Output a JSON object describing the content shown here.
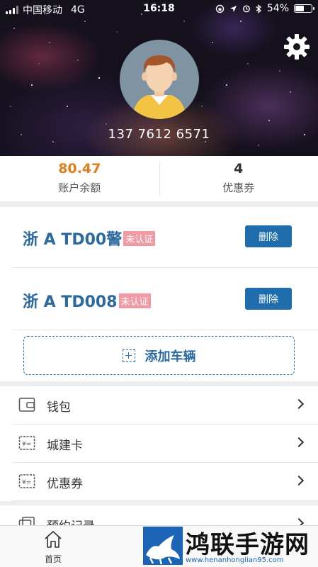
{
  "status_bar": {
    "carrier": "中国移动",
    "network": "4G",
    "time": "16:18",
    "battery": "54%",
    "battery_level": 0.54
  },
  "profile": {
    "phone": "137 7612 6571"
  },
  "summary": {
    "balance_value": "80.47",
    "balance_label": "账户余额",
    "coupon_value": "4",
    "coupon_label": "优惠券",
    "balance_color": "#e07d1c"
  },
  "vehicles": [
    {
      "plate": "浙 A TD00警",
      "status": "未认证",
      "action": "删除"
    },
    {
      "plate": "浙 A TD008",
      "status": "未认证",
      "action": "删除"
    }
  ],
  "add_vehicle": {
    "label": "添加车辆"
  },
  "menu": [
    {
      "label": "钱包",
      "icon": "wallet-icon"
    },
    {
      "label": "城建卡",
      "icon": "card-icon"
    },
    {
      "label": "优惠券",
      "icon": "coupon-icon"
    },
    {
      "label": "预约记录",
      "icon": "record-icon"
    }
  ],
  "tabbar": {
    "home_label": "首页"
  },
  "watermark": {
    "title": "鸿联手游网",
    "url": "www.henanhonglian95.com"
  },
  "colors": {
    "accent": "#1f6dac",
    "plate_text": "#2c6aa0",
    "badge": "#f19aa3"
  }
}
